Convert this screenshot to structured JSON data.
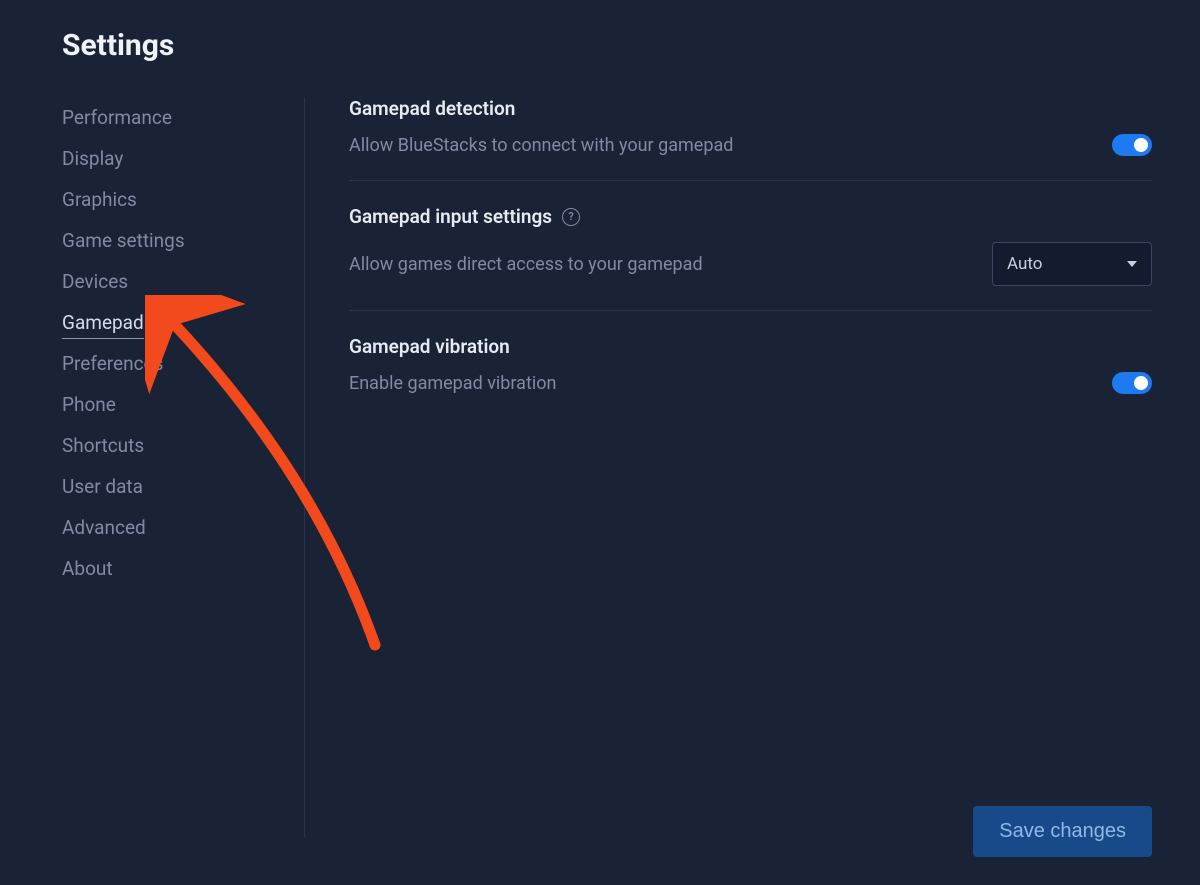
{
  "page_title": "Settings",
  "sidebar": {
    "items": [
      {
        "label": "Performance",
        "active": false
      },
      {
        "label": "Display",
        "active": false
      },
      {
        "label": "Graphics",
        "active": false
      },
      {
        "label": "Game settings",
        "active": false
      },
      {
        "label": "Devices",
        "active": false
      },
      {
        "label": "Gamepad",
        "active": true
      },
      {
        "label": "Preferences",
        "active": false
      },
      {
        "label": "Phone",
        "active": false
      },
      {
        "label": "Shortcuts",
        "active": false
      },
      {
        "label": "User data",
        "active": false
      },
      {
        "label": "Advanced",
        "active": false
      },
      {
        "label": "About",
        "active": false
      }
    ]
  },
  "main": {
    "sections": [
      {
        "title": "Gamepad detection",
        "desc": "Allow BlueStacks to connect with your gamepad",
        "control": "toggle",
        "toggle_on": true
      },
      {
        "title": "Gamepad input settings",
        "has_help": true,
        "desc": "Allow games direct access to your gamepad",
        "control": "select",
        "select_value": "Auto"
      },
      {
        "title": "Gamepad vibration",
        "desc": "Enable gamepad vibration",
        "control": "toggle",
        "toggle_on": true
      }
    ]
  },
  "footer": {
    "save_label": "Save changes"
  },
  "colors": {
    "background": "#1a2236",
    "accent": "#1d7af0",
    "text_primary": "#e7eaf1",
    "text_secondary": "#808aa3",
    "annotation": "#f24a1d"
  }
}
